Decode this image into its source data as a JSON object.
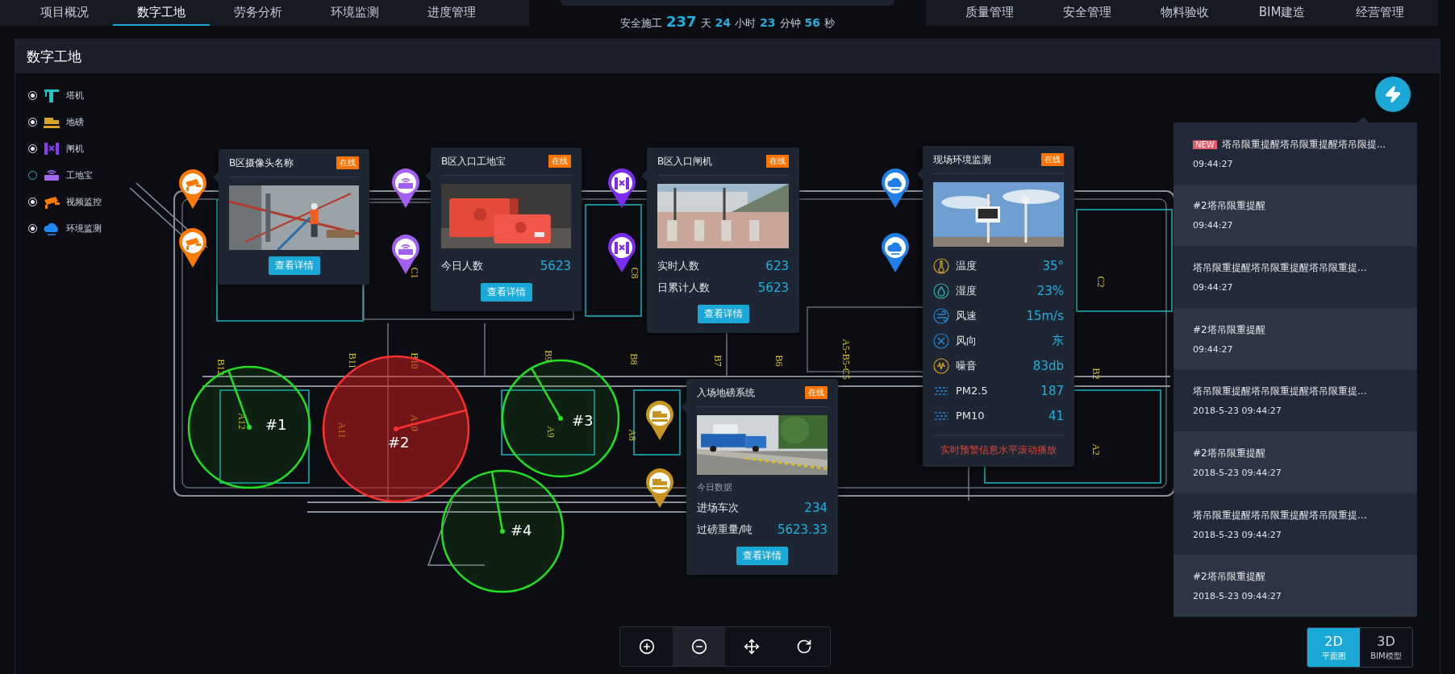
{
  "nav": {
    "left_tabs": [
      {
        "label": "项目概况",
        "selected": false
      },
      {
        "label": "数字工地",
        "selected": true
      },
      {
        "label": "劳务分析",
        "selected": false
      },
      {
        "label": "环境监测",
        "selected": false
      },
      {
        "label": "进度管理",
        "selected": false
      }
    ],
    "timer": {
      "label": "安全施工",
      "parts": [
        {
          "value": "237",
          "unit": "天"
        },
        {
          "value": "24",
          "unit": "小时"
        },
        {
          "value": "23",
          "unit": "分钟"
        },
        {
          "value": "56",
          "unit": "秒"
        }
      ]
    },
    "right_tabs": [
      {
        "label": "质量管理",
        "selected": false
      },
      {
        "label": "安全管理",
        "selected": false
      },
      {
        "label": "物料验收",
        "selected": false
      },
      {
        "label": "BIM建造",
        "selected": false
      },
      {
        "label": "经营管理",
        "selected": false
      }
    ]
  },
  "panel": {
    "title": "数字工地"
  },
  "legend": [
    {
      "kind": "crane",
      "label": "塔机",
      "checked": true
    },
    {
      "kind": "scale",
      "label": "地磅",
      "checked": true
    },
    {
      "kind": "gate",
      "label": "闸机",
      "checked": true
    },
    {
      "kind": "gadget",
      "label": "工地宝",
      "checked": false
    },
    {
      "kind": "camera",
      "label": "视频监控",
      "checked": true
    },
    {
      "kind": "env",
      "label": "环境监测",
      "checked": true
    }
  ],
  "map": {
    "zones": [
      "B12",
      "B11",
      "B10",
      "B9",
      "B8",
      "B7",
      "B6",
      "A5-B5-C5",
      "B2",
      "A2",
      "A12",
      "A11",
      "A10",
      "A9",
      "A8",
      "C1",
      "C8",
      "C2"
    ],
    "cranes": [
      {
        "label": "#1",
        "alarm": false
      },
      {
        "label": "#2",
        "alarm": true
      },
      {
        "label": "#3",
        "alarm": false
      },
      {
        "label": "#4",
        "alarm": false
      }
    ],
    "pins": [
      {
        "kind": "camera"
      },
      {
        "kind": "camera"
      },
      {
        "kind": "gadget"
      },
      {
        "kind": "gadget"
      },
      {
        "kind": "gate"
      },
      {
        "kind": "gate"
      },
      {
        "kind": "env"
      },
      {
        "kind": "env"
      },
      {
        "kind": "scale"
      },
      {
        "kind": "scale"
      }
    ],
    "popups": [
      {
        "kind": "camera",
        "title": "B区摄像头名称",
        "status": "在线",
        "button": "查看详情"
      },
      {
        "kind": "gadget",
        "title": "B区入口工地宝",
        "status": "在线",
        "rows": [
          {
            "label": "今日人数",
            "value": "5623"
          }
        ],
        "button": "查看详情"
      },
      {
        "kind": "gate",
        "title": "B区入口闸机",
        "status": "在线",
        "rows": [
          {
            "label": "实时人数",
            "value": "623"
          },
          {
            "label": "日累计人数",
            "value": "5623"
          }
        ],
        "button": "查看详情"
      },
      {
        "kind": "env",
        "title": "现场环境监测",
        "status": "在线",
        "rows": [
          {
            "kind": "temperature",
            "label": "温度",
            "value": "35°"
          },
          {
            "kind": "humidity",
            "label": "湿度",
            "value": "23%"
          },
          {
            "kind": "wind_speed",
            "label": "风速",
            "value": "15m/s"
          },
          {
            "kind": "wind_direction",
            "label": "风向",
            "value": "东"
          },
          {
            "kind": "noise",
            "label": "噪音",
            "value": "83db"
          },
          {
            "kind": "pm",
            "label": "PM2.5",
            "value": "187"
          },
          {
            "kind": "pm",
            "label": "PM10",
            "value": "41"
          }
        ],
        "note": "实时预警信息水平滚动播放"
      },
      {
        "kind": "scale",
        "title": "入场地磅系统",
        "status": "在线",
        "section": "今日数据",
        "rows": [
          {
            "label": "进场车次",
            "value": "234"
          },
          {
            "label": "过磅重量/吨",
            "value": "5623.33"
          }
        ],
        "button": "查看详情"
      }
    ]
  },
  "alerts": [
    {
      "badge": "NEW",
      "text": "塔吊限重提醒塔吊限重提醒塔吊限提...",
      "time": "09:44:27"
    },
    {
      "text": "#2塔吊限重提醒",
      "time": "09:44:27"
    },
    {
      "text": "塔吊限重提醒塔吊限重提醒塔吊限重提...",
      "time": "09:44:27"
    },
    {
      "text": "#2塔吊限重提醒",
      "time": "09:44:27"
    },
    {
      "text": "塔吊限重提醒塔吊限重提醒塔吊限重提...",
      "time": "2018-5-23 09:44:27"
    },
    {
      "text": "#2塔吊限重提醒",
      "time": "2018-5-23 09:44:27"
    },
    {
      "text": "塔吊限重提醒塔吊限重提醒塔吊限重提...",
      "time": "2018-5-23 09:44:27"
    },
    {
      "text": "#2塔吊限重提醒",
      "time": "2018-5-23 09:44:27"
    }
  ],
  "map_controls": [
    {
      "kind": "zoom_in",
      "selected": false
    },
    {
      "kind": "zoom_out",
      "selected": true
    },
    {
      "kind": "pan",
      "selected": false
    },
    {
      "kind": "rotate",
      "selected": false
    }
  ],
  "view_modes": [
    {
      "label": "2D",
      "caption": "平面图",
      "selected": true
    },
    {
      "label": "3D",
      "caption": "BIM模型",
      "selected": false
    }
  ]
}
